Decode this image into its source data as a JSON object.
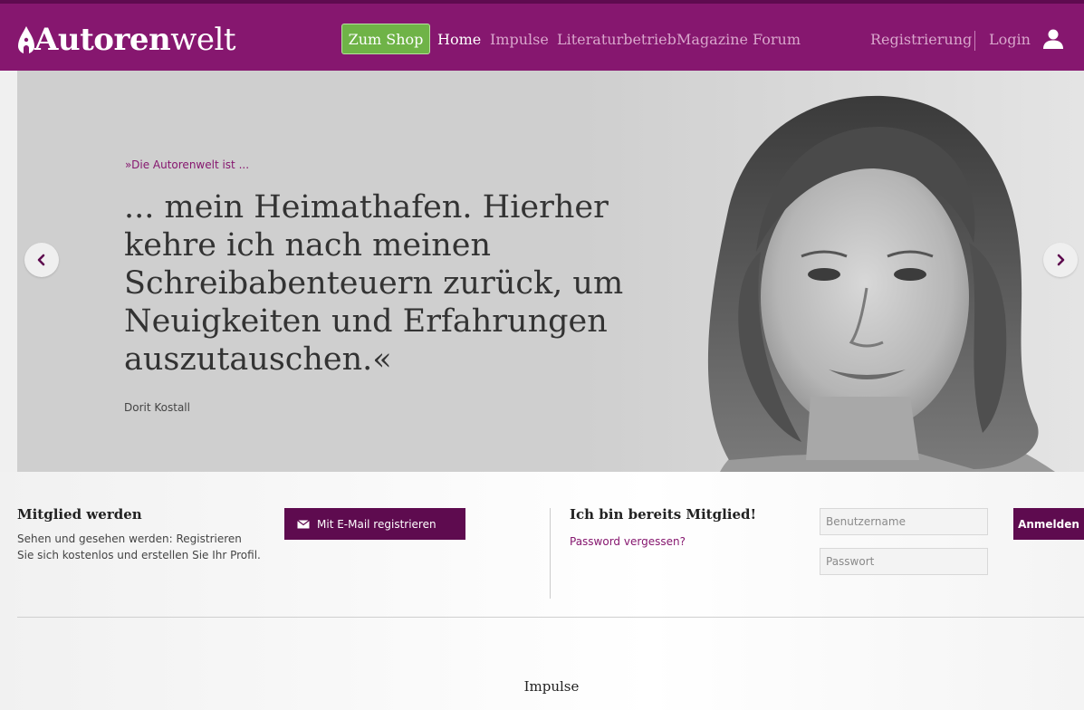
{
  "header": {
    "logo_bold": "Autoren",
    "logo_regular": "welt",
    "shop_button": "Zum Shop",
    "nav": [
      "Home",
      "Impulse",
      "Literaturbetrieb",
      "Magazine",
      "Forum"
    ],
    "register": "Registrierung",
    "login": "Login"
  },
  "hero": {
    "kicker": "»Die Autorenwelt ist ...",
    "quote": "... mein Heimathafen. Hierher kehre ich nach meinen Schreibabenteuern zurück, um Neuigkeiten und Erfahrungen auszutauschen.«",
    "author": "Dorit Kostall"
  },
  "join": {
    "title": "Mitglied werden",
    "text": "Sehen und gesehen werden: Registrieren Sie sich kostenlos und erstellen Sie Ihr Profil.",
    "email_button": "Mit E-Mail registrieren"
  },
  "member": {
    "title": "Ich bin bereits Mitglied!",
    "forgot": "Password vergessen?",
    "username_placeholder": "Benutzername",
    "password_placeholder": "Passwort",
    "login_button": "Anmelden"
  },
  "impulse": {
    "title": "Impulse"
  },
  "colors": {
    "brand": "#86176f",
    "brand_dark": "#5e0b4f",
    "shop_green": "#6fb347"
  }
}
